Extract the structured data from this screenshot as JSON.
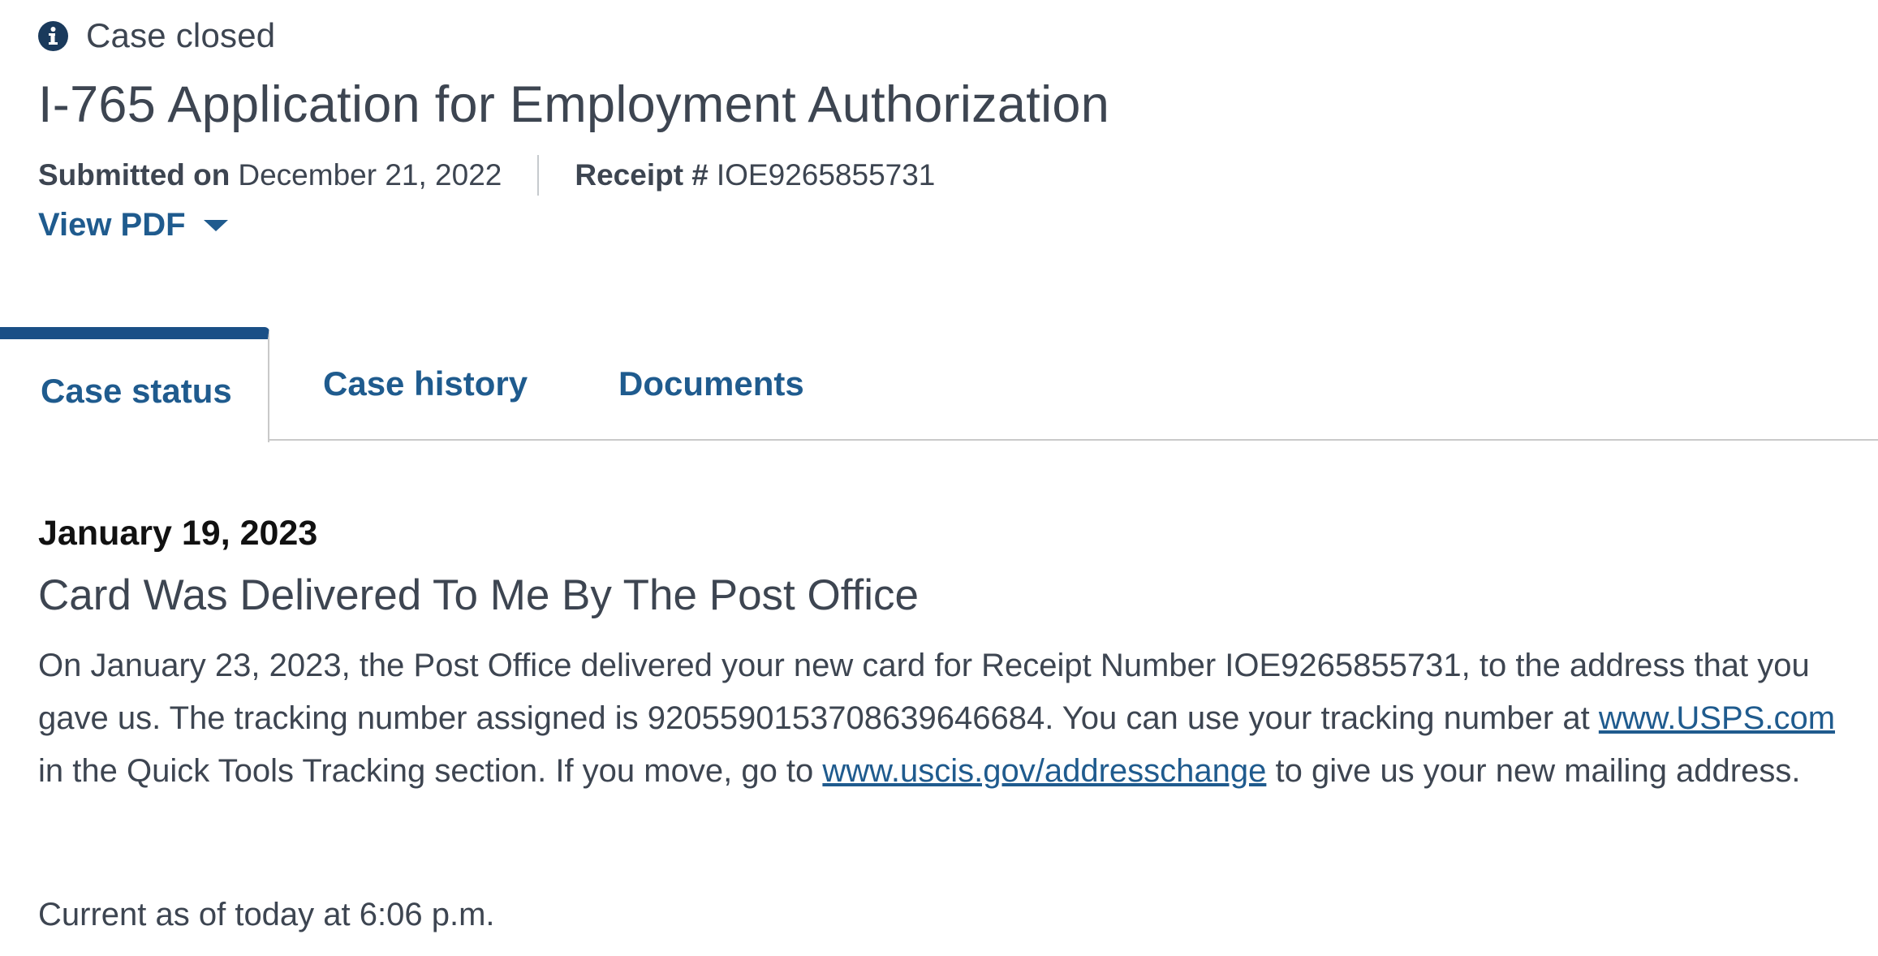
{
  "case_state": {
    "icon": "info-circle-icon",
    "label": "Case closed",
    "icon_color": "#1a3a5c"
  },
  "form": {
    "title": "I-765 Application for Employment Authorization",
    "submitted_label": "Submitted on",
    "submitted_date": "December 21, 2022",
    "receipt_label": "Receipt #",
    "receipt_number": "IOE9265855731",
    "view_pdf_label": "View PDF",
    "view_pdf_icon": "caret-down-icon"
  },
  "tabs": [
    {
      "label": "Case status",
      "active": true
    },
    {
      "label": "Case history",
      "active": false
    },
    {
      "label": "Documents",
      "active": false
    }
  ],
  "status": {
    "date": "January 19, 2023",
    "title": "Card Was Delivered To Me By The Post Office",
    "body_part1": "On January 23, 2023, the Post Office delivered your new card for Receipt Number IOE9265855731, to the address that you gave us. The tracking number assigned is 9205590153708639646684. You can use your tracking number at ",
    "link1": "www.USPS.com",
    "body_part2": " in the Quick Tools Tracking section. If you move, go to ",
    "link2": "www.uscis.gov/addresschange",
    "body_part3": " to give us your new mailing address."
  },
  "current_as_of": "Current as of today at 6:06 p.m.",
  "colors": {
    "link": "#1f5b8e",
    "active_tab_bar": "#1a4f86",
    "text": "#3d4551"
  }
}
